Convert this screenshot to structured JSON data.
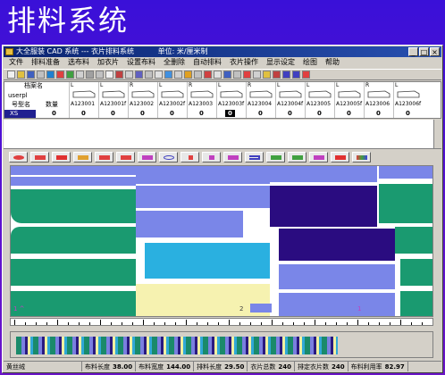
{
  "slide": {
    "title": "排料系统"
  },
  "window": {
    "title": "大全服装 CAD 系统 --- 衣片排料系统",
    "units": "单位: 米/厘米制",
    "buttons": [
      "_",
      "□",
      "×"
    ]
  },
  "menu": [
    "文件",
    "排料准备",
    "选布料",
    "加衣片",
    "设置布料",
    "全删除",
    "自动排料",
    "衣片操作",
    "显示设定",
    "绘图",
    "帮助"
  ],
  "piece_header": {
    "file_label": "档案名",
    "user": "userpl",
    "size_label": "号型名",
    "qty_label": "数量",
    "size_value": "XS",
    "size_qty": "0"
  },
  "pieces": [
    {
      "side": "L",
      "code": "A123001",
      "count": "0"
    },
    {
      "side": "L",
      "code": "A123001f",
      "count": "0"
    },
    {
      "side": "R",
      "code": "A123002",
      "count": "0"
    },
    {
      "side": "L",
      "code": "A123002f",
      "count": "0"
    },
    {
      "side": "R",
      "code": "A123003",
      "count": "0"
    },
    {
      "side": "L",
      "code": "A123003f",
      "count": "0"
    },
    {
      "side": "R",
      "code": "A123004",
      "count": "0"
    },
    {
      "side": "L",
      "code": "A123004f",
      "count": "0"
    },
    {
      "side": "L",
      "code": "A123005",
      "count": "0"
    },
    {
      "side": "L",
      "code": "A123005f",
      "count": "0"
    },
    {
      "side": "R",
      "code": "A123006",
      "count": "0"
    },
    {
      "side": "L",
      "code": "A123006f",
      "count": "0"
    }
  ],
  "canvas_labels": {
    "left": "1 ^",
    "mid": "2",
    "right": "1"
  },
  "status": {
    "name": "黄丝绒",
    "fabric_length_label": "布料长度",
    "fabric_length": "38.00",
    "fabric_width_label": "布料宽度",
    "fabric_width": "144.00",
    "marker_length_label": "排料长度",
    "marker_length": "29.50",
    "total_pieces_label": "衣片总数",
    "total_pieces": "240",
    "placed_pieces_label": "排定衣片数",
    "placed_pieces": "240",
    "utilization_label": "布料利用率",
    "utilization": "82.97"
  },
  "colors": {
    "green": "#1a9a70",
    "light_blue": "#7a86e8",
    "navy": "#2a0c80",
    "cyan": "#2ab0e0",
    "cream": "#f6f2b0"
  }
}
